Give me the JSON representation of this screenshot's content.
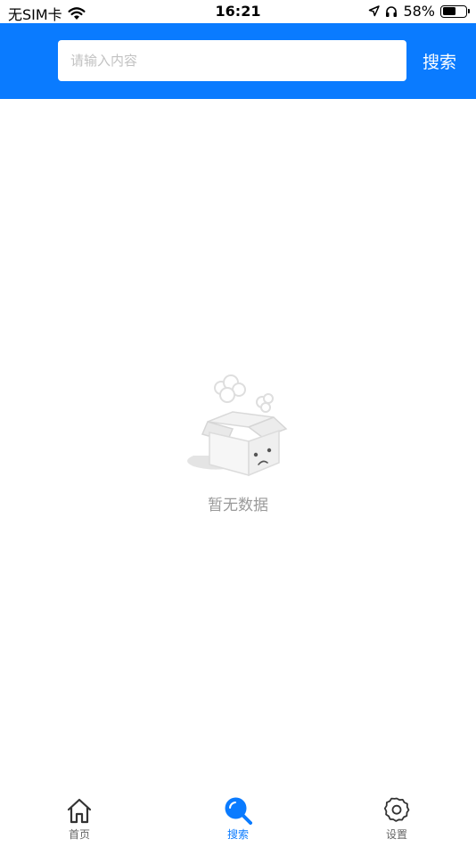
{
  "status_bar": {
    "carrier": "无SIM卡",
    "time": "16:21",
    "battery": "58%",
    "battery_level": 0.58
  },
  "header": {
    "search_placeholder": "请输入内容",
    "search_value": "",
    "search_button": "搜索",
    "background_color": "#0a7bff"
  },
  "empty_state": {
    "message": "暂无数据",
    "icon": "empty-box-icon"
  },
  "tab_bar": {
    "active_color": "#0a7bff",
    "tabs": [
      {
        "label": "首页",
        "icon": "home-icon",
        "active": false
      },
      {
        "label": "搜索",
        "icon": "search-icon",
        "active": true
      },
      {
        "label": "设置",
        "icon": "gear-icon",
        "active": false
      }
    ]
  }
}
